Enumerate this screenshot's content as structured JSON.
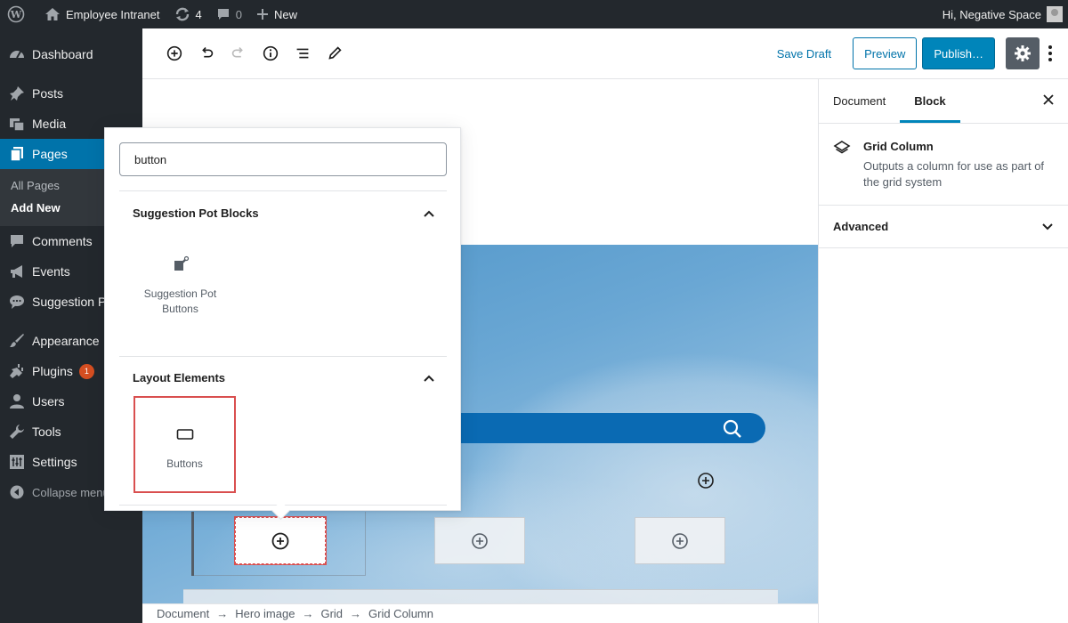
{
  "adminbar": {
    "site_name": "Employee Intranet",
    "updates_count": "4",
    "comments_count": "0",
    "new_label": "New",
    "greeting": "Hi, Negative Space"
  },
  "menu": {
    "dashboard": "Dashboard",
    "posts": "Posts",
    "media": "Media",
    "pages": "Pages",
    "sub_all_pages": "All Pages",
    "sub_add_new": "Add New",
    "comments": "Comments",
    "events": "Events",
    "suggestion": "Suggestion P",
    "appearance": "Appearance",
    "plugins": "Plugins",
    "plugins_badge": "1",
    "users": "Users",
    "tools": "Tools",
    "settings": "Settings",
    "collapse": "Collapse menu"
  },
  "header": {
    "save_draft": "Save Draft",
    "preview": "Preview",
    "publish": "Publish…"
  },
  "inserter": {
    "search_value": "button",
    "section1_title": "Suggestion Pot Blocks",
    "section1_block_line1": "Suggestion Pot",
    "section1_block_line2": "Buttons",
    "section2_title": "Layout Elements",
    "section2_block": "Buttons"
  },
  "sidebar": {
    "tab_document": "Document",
    "tab_block": "Block",
    "block_title": "Grid Column",
    "block_desc": "Outputs a column for use as part of the grid system",
    "panel_advanced": "Advanced"
  },
  "breadcrumb": {
    "items": [
      "Document",
      "Hero image",
      "Grid",
      "Grid Column"
    ],
    "separator": "→"
  },
  "colors": {
    "admin_dark": "#23282d",
    "accent_blue": "#0073aa",
    "publish_blue": "#0085ba",
    "highlight_red": "#d94f4f",
    "badge_orange": "#d54e21"
  }
}
